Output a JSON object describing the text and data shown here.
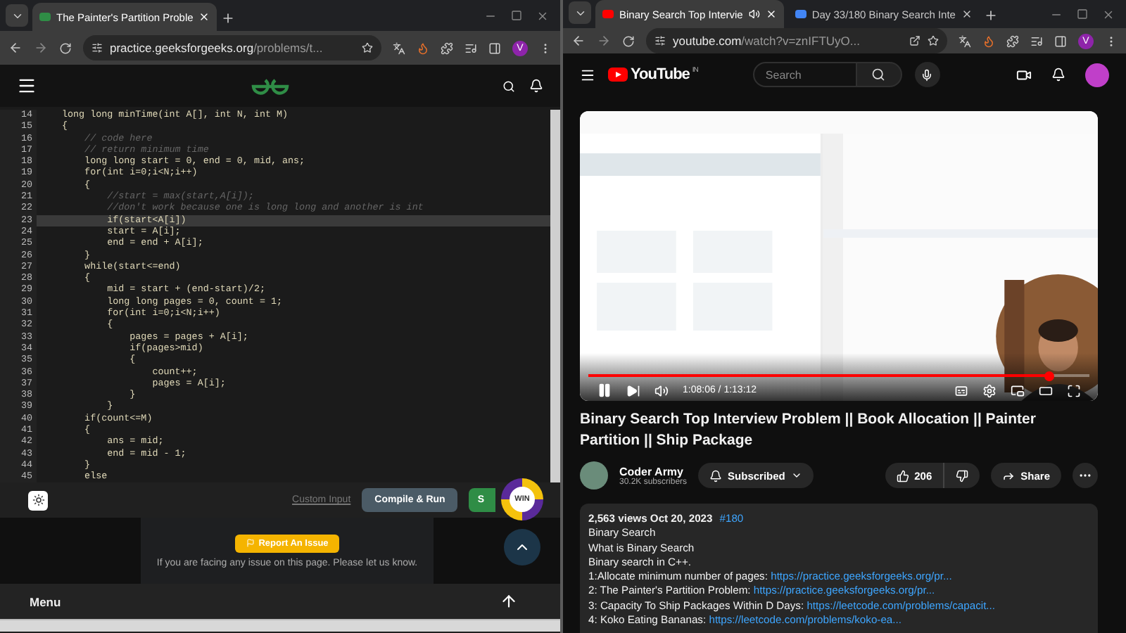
{
  "left_window": {
    "tabs": [
      {
        "title": "The Painter's Partition Proble",
        "selected": true
      }
    ],
    "address": {
      "host": "practice.geeksforgeeks.org",
      "path": "/problems/t..."
    },
    "profile": "V",
    "code_lines": [
      {
        "number": "14",
        "text": "long long minTime(int A[], int N, int M)",
        "kind": "code",
        "current": false
      },
      {
        "number": "15",
        "text": "{",
        "kind": "code",
        "current": false
      },
      {
        "number": "16",
        "text": "    // code here",
        "kind": "comment",
        "current": false
      },
      {
        "number": "17",
        "text": "    // return minimum time",
        "kind": "comment",
        "current": false
      },
      {
        "number": "18",
        "text": "    long long start = 0, end = 0, mid, ans;",
        "kind": "code",
        "current": false
      },
      {
        "number": "19",
        "text": "    for(int i=0;i<N;i++)",
        "kind": "code",
        "current": false
      },
      {
        "number": "20",
        "text": "    {",
        "kind": "code",
        "current": false
      },
      {
        "number": "21",
        "text": "        //start = max(start,A[i]);",
        "kind": "comment",
        "current": false
      },
      {
        "number": "22",
        "text": "        //don't work because one is long long and another is int",
        "kind": "comment",
        "current": false
      },
      {
        "number": "23",
        "text": "        if(start<A[i])",
        "kind": "code",
        "current": true
      },
      {
        "number": "24",
        "text": "        start = A[i];",
        "kind": "code",
        "current": false
      },
      {
        "number": "25",
        "text": "        end = end + A[i];",
        "kind": "code",
        "current": false
      },
      {
        "number": "26",
        "text": "    }",
        "kind": "code",
        "current": false
      },
      {
        "number": "27",
        "text": "    while(start<=end)",
        "kind": "code",
        "current": false
      },
      {
        "number": "28",
        "text": "    {",
        "kind": "code",
        "current": false
      },
      {
        "number": "29",
        "text": "        mid = start + (end-start)/2;",
        "kind": "code",
        "current": false
      },
      {
        "number": "30",
        "text": "        long long pages = 0, count = 1;",
        "kind": "code",
        "current": false
      },
      {
        "number": "31",
        "text": "        for(int i=0;i<N;i++)",
        "kind": "code",
        "current": false
      },
      {
        "number": "32",
        "text": "        {",
        "kind": "code",
        "current": false
      },
      {
        "number": "33",
        "text": "            pages = pages + A[i];",
        "kind": "code",
        "current": false
      },
      {
        "number": "34",
        "text": "            if(pages>mid)",
        "kind": "code",
        "current": false
      },
      {
        "number": "35",
        "text": "            {",
        "kind": "code",
        "current": false
      },
      {
        "number": "36",
        "text": "                count++;",
        "kind": "code",
        "current": false
      },
      {
        "number": "37",
        "text": "                pages = A[i];",
        "kind": "code",
        "current": false
      },
      {
        "number": "38",
        "text": "            }",
        "kind": "code",
        "current": false
      },
      {
        "number": "39",
        "text": "        }",
        "kind": "code",
        "current": false
      },
      {
        "number": "40",
        "text": "    if(count<=M)",
        "kind": "code",
        "current": false
      },
      {
        "number": "41",
        "text": "    {",
        "kind": "code",
        "current": false
      },
      {
        "number": "42",
        "text": "        ans = mid;",
        "kind": "code",
        "current": false
      },
      {
        "number": "43",
        "text": "        end = mid - 1;",
        "kind": "code",
        "current": false
      },
      {
        "number": "44",
        "text": "    }",
        "kind": "code",
        "current": false
      },
      {
        "number": "45",
        "text": "    else",
        "kind": "code",
        "current": false
      }
    ],
    "toolbar": {
      "custom_input": "Custom Input",
      "compile": "Compile & Run",
      "submit": "S",
      "badge": "WIN"
    },
    "report": {
      "button": "Report An Issue",
      "note": "If you are facing any issue on this page. Please let us know."
    },
    "menu": "Menu"
  },
  "right_window": {
    "tabs": [
      {
        "title": "Binary Search Top Intervie",
        "selected": true,
        "audio": true
      },
      {
        "title": "Day 33/180 Binary Search Inte",
        "selected": false,
        "audio": false
      }
    ],
    "address": {
      "host": "youtube.com",
      "path": "/watch?v=znIFTUyO..."
    },
    "profile": "V",
    "youtube": {
      "logo": "YouTube",
      "region": "IN",
      "search_placeholder": "Search",
      "player": {
        "playing": true,
        "time": "1:08:06 / 1:13:12",
        "level": 0.92
      },
      "title": "Binary Search Top Interview Problem || Book Allocation || Painter Partition || Ship Package",
      "channel": "Coder Army",
      "subscribers": "30.2K subscribers",
      "subscribe": "Subscribed",
      "likes": "206",
      "share": "Share",
      "description": {
        "meta": "2,563 views  Oct 20, 2023",
        "hashtag": "#180",
        "lines": [
          {
            "text": "Binary Search"
          },
          {
            "text": "What is Binary Search"
          },
          {
            "text": "Binary search in C++."
          },
          {
            "text": "1:Allocate minimum number of pages:",
            "link": "https://practice.geeksforgeeks.org/pr..."
          },
          {
            "text": "2: The Painter's Partition Problem:",
            "link": "https://practice.geeksforgeeks.org/pr..."
          },
          {
            "text": "3: Capacity To Ship Packages Within D Days:",
            "link": "https://leetcode.com/problems/capacit..."
          },
          {
            "text": "4: Koko Eating Bananas:",
            "link": "https://leetcode.com/problems/koko-ea..."
          }
        ]
      }
    }
  }
}
